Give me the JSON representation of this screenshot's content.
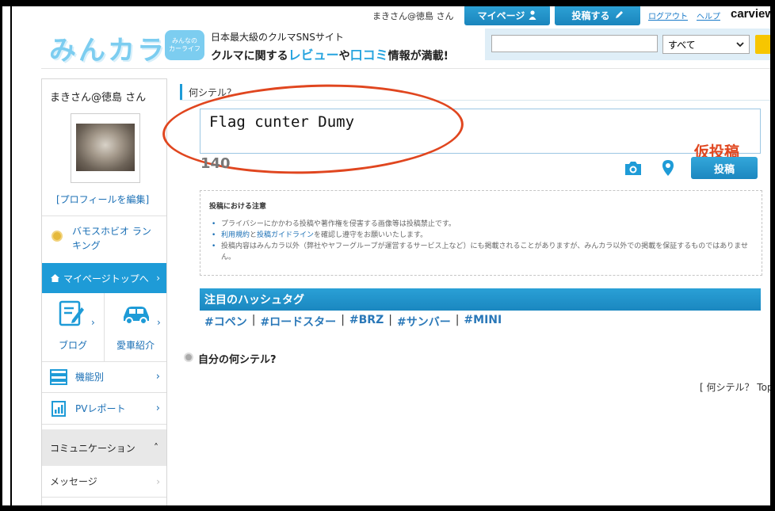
{
  "header": {
    "user_greeting": "まきさん@徳島 さん",
    "mypage_label": "マイページ",
    "post_label": "投稿する",
    "logout_label": "ログアウト",
    "help_label": "ヘルプ",
    "carview_logo": "carview",
    "site_logo": "みんカラ",
    "badge_line1": "みんなの",
    "badge_line2": "カーライフ",
    "tagline_top": "日本最大級のクルマSNSサイト",
    "tagline_a": "クルマに関する",
    "tagline_review": "レビュー",
    "tagline_b": "や",
    "tagline_kuchikomi": "口コミ",
    "tagline_c": "情報が満載!",
    "search_value": "",
    "search_scope": "すべて"
  },
  "sidebar": {
    "username": "まきさん@徳島 さん",
    "edit_profile": "[プロフィールを編集]",
    "ranking": "バモスホビオ ランキング",
    "mypage_top": "マイページトップへ",
    "blog": "ブログ",
    "car_intro": "愛車紹介",
    "features": "機能別",
    "pv_report": "PVレポート",
    "communication": "コミュニケーション",
    "messages": "メッセージ"
  },
  "post": {
    "section_title": "何シテル？",
    "text": "Flag cunter Dumy",
    "counter": "140",
    "annotation": "仮投稿",
    "submit_label": "投稿"
  },
  "notice": {
    "title": "投稿における注意",
    "item1": "プライバシーにかかわる投稿や著作権を侵害する画像等は投稿禁止です。",
    "item2_link1": "利用規約",
    "item2_mid": "と",
    "item2_link2": "投稿ガイドライン",
    "item2_tail": "を確認し遵守をお願いいたします。",
    "item3": "投稿内容はみんカラ以外（弊社やヤフーグループが運営するサービス上など）にも掲載されることがありますが、みんカラ以外での掲載を保証するものではありません。"
  },
  "hashtags": {
    "title": "注目のハッシュタグ",
    "tags": [
      "#コペン",
      "#ロードスター",
      "#BRZ",
      "#サンバー",
      "#MINI"
    ],
    "separator": "|"
  },
  "own": {
    "label": "自分の何シテル?",
    "link_text": "[ 何シテル？ Top"
  },
  "colors": {
    "accent_blue": "#1e9bd7",
    "annotation_red": "#e0461f",
    "link_blue": "#1a6fb5"
  }
}
